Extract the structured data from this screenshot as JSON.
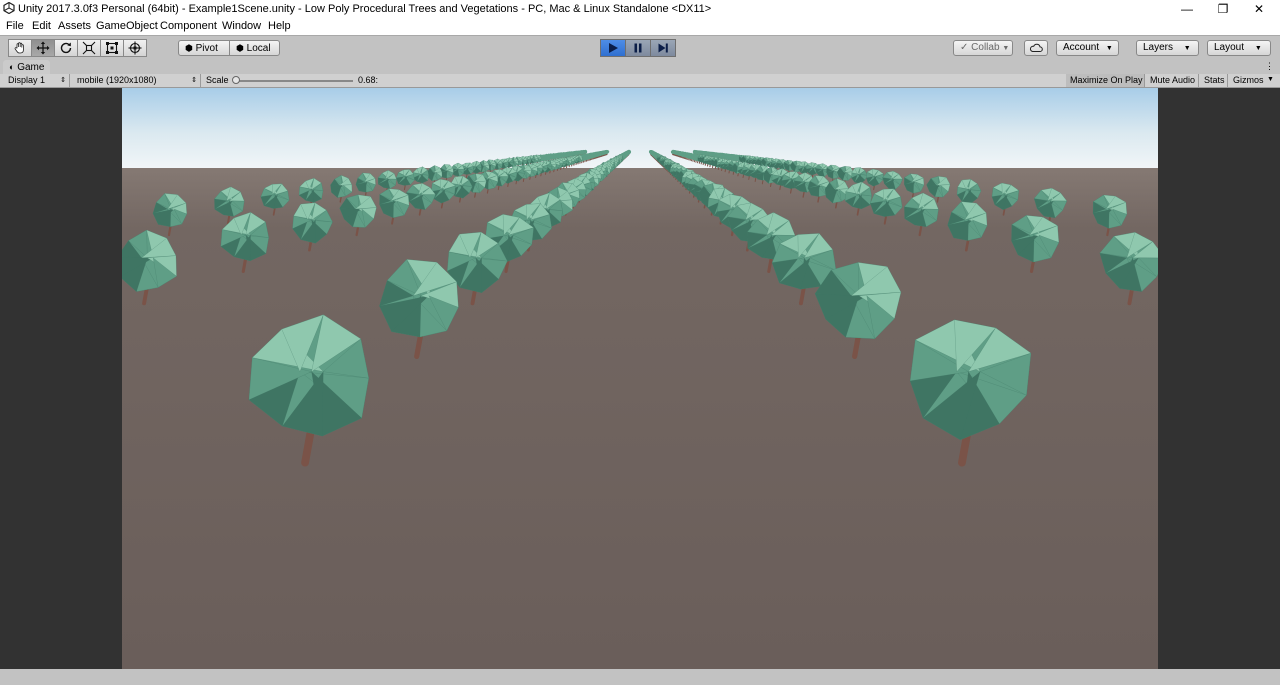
{
  "window": {
    "title": "Unity 2017.3.0f3 Personal (64bit) - Example1Scene.unity - Low Poly Procedural Trees and Vegetations - PC, Mac & Linux Standalone <DX11>",
    "minimize": "—",
    "restore": "❐",
    "close": "✕"
  },
  "menu": [
    "File",
    "Edit",
    "Assets",
    "GameObject",
    "Component",
    "Window",
    "Help"
  ],
  "toolbar": {
    "tools": [
      "hand-tool",
      "move-tool",
      "rotate-tool",
      "scale-tool",
      "rect-tool",
      "transform-tool"
    ],
    "active_tool": "move-tool",
    "pivot_label": "Pivot",
    "local_label": "Local",
    "collab_label": "Collab",
    "account_label": "Account",
    "layers_label": "Layers",
    "layout_label": "Layout"
  },
  "game_tab": {
    "label": "Game"
  },
  "game_bar": {
    "display": "Display 1",
    "resolution": "mobile (1920x1080)",
    "scale_label": "Scale",
    "scale_value": "0.68:",
    "maximize": "Maximize On Play",
    "mute": "Mute Audio",
    "stats": "Stats",
    "gizmos": "Gizmos"
  },
  "colors": {
    "ground": "#6b5f5b",
    "sky_top": "#a8cde8",
    "sky_horizon": "#f2f6f8",
    "foliage": "#5f9e86",
    "foliage_light": "#8fc8ae",
    "foliage_dark": "#3f7563",
    "trunk": "#7a5348",
    "play_active": "#2f6fd0"
  }
}
